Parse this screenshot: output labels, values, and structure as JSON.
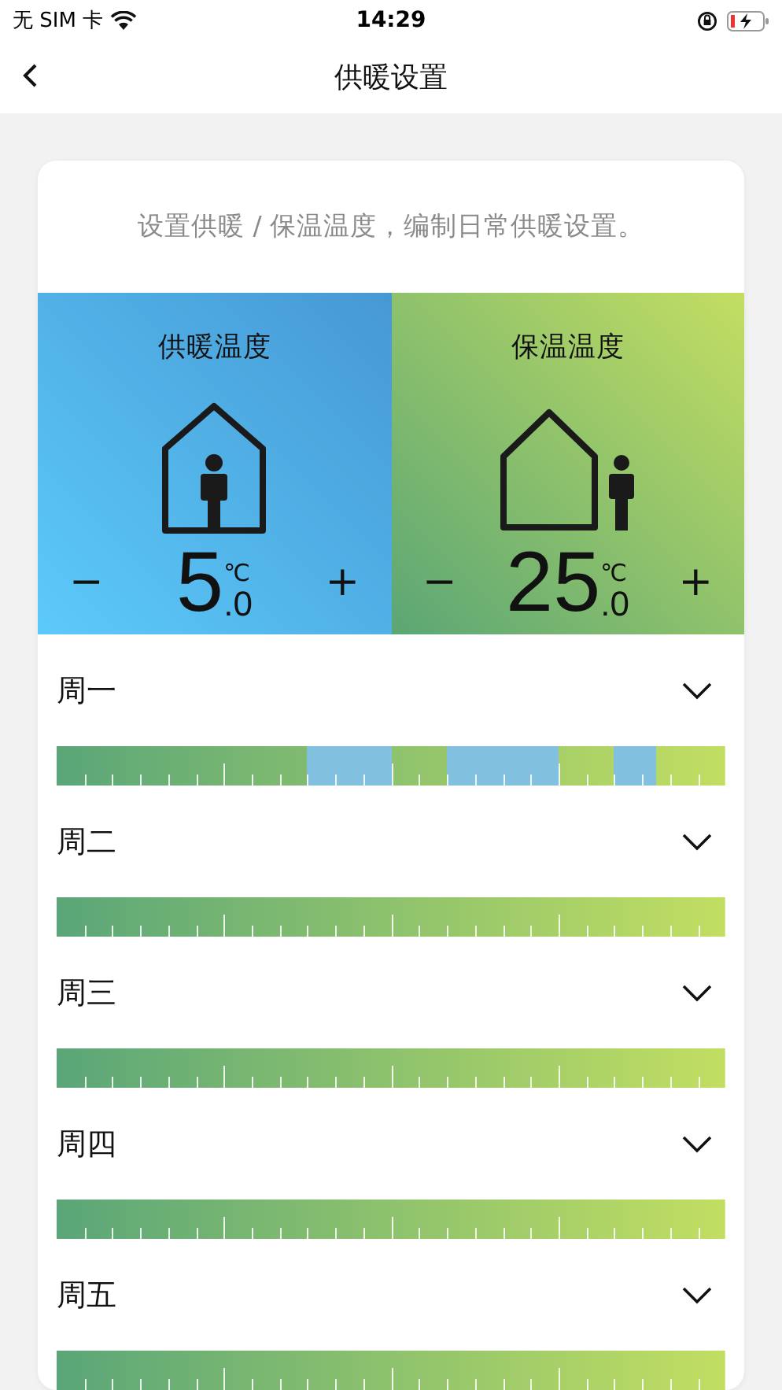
{
  "status_bar": {
    "carrier": "无 SIM 卡",
    "time": "14:29"
  },
  "nav": {
    "title": "供暖设置"
  },
  "intro": "设置供暖 / 保温温度，编制日常供暖设置。",
  "modes": [
    {
      "kind": "heating",
      "title": "供暖温度",
      "whole": "5",
      "fraction": ".0",
      "unit": "℃",
      "minus": "−",
      "plus": "+"
    },
    {
      "kind": "keeping",
      "title": "保温温度",
      "whole": "25",
      "fraction": ".0",
      "unit": "℃",
      "minus": "−",
      "plus": "+"
    }
  ],
  "days": [
    {
      "label": "周一",
      "expanded": false,
      "slots": [
        {
          "kind": "keeping"
        },
        {
          "kind": "keeping"
        },
        {
          "kind": "keeping"
        },
        {
          "kind": "keeping"
        },
        {
          "kind": "keeping"
        },
        {
          "kind": "keeping"
        },
        {
          "kind": "keeping"
        },
        {
          "kind": "keeping"
        },
        {
          "kind": "keeping"
        },
        {
          "kind": "keeping"
        },
        {
          "kind": "keeping"
        },
        {
          "kind": "keeping"
        },
        {
          "kind": "keeping"
        },
        {
          "kind": "keeping"
        },
        {
          "kind": "keeping"
        },
        {
          "kind": "keeping"
        },
        {
          "kind": "keeping"
        },
        {
          "kind": "keeping"
        },
        {
          "kind": "heating"
        },
        {
          "kind": "heating"
        },
        {
          "kind": "heating"
        },
        {
          "kind": "heating"
        },
        {
          "kind": "heating"
        },
        {
          "kind": "heating"
        },
        {
          "kind": "keeping"
        },
        {
          "kind": "keeping"
        },
        {
          "kind": "keeping"
        },
        {
          "kind": "keeping"
        },
        {
          "kind": "heating"
        },
        {
          "kind": "heating"
        },
        {
          "kind": "heating"
        },
        {
          "kind": "heating"
        },
        {
          "kind": "heating"
        },
        {
          "kind": "heating"
        },
        {
          "kind": "heating"
        },
        {
          "kind": "heating"
        },
        {
          "kind": "keeping"
        },
        {
          "kind": "keeping"
        },
        {
          "kind": "keeping"
        },
        {
          "kind": "keeping"
        },
        {
          "kind": "heating"
        },
        {
          "kind": "heating"
        },
        {
          "kind": "heating"
        },
        {
          "kind": "keeping"
        },
        {
          "kind": "keeping"
        },
        {
          "kind": "keeping"
        },
        {
          "kind": "keeping"
        },
        {
          "kind": "keeping"
        }
      ]
    },
    {
      "label": "周二",
      "expanded": false,
      "slots": [
        {
          "kind": "keeping"
        },
        {
          "kind": "keeping"
        },
        {
          "kind": "keeping"
        },
        {
          "kind": "keeping"
        },
        {
          "kind": "keeping"
        },
        {
          "kind": "keeping"
        },
        {
          "kind": "keeping"
        },
        {
          "kind": "keeping"
        },
        {
          "kind": "keeping"
        },
        {
          "kind": "keeping"
        },
        {
          "kind": "keeping"
        },
        {
          "kind": "keeping"
        },
        {
          "kind": "keeping"
        },
        {
          "kind": "keeping"
        },
        {
          "kind": "keeping"
        },
        {
          "kind": "keeping"
        },
        {
          "kind": "keeping"
        },
        {
          "kind": "keeping"
        },
        {
          "kind": "keeping"
        },
        {
          "kind": "keeping"
        },
        {
          "kind": "keeping"
        },
        {
          "kind": "keeping"
        },
        {
          "kind": "keeping"
        },
        {
          "kind": "keeping"
        },
        {
          "kind": "keeping"
        },
        {
          "kind": "keeping"
        },
        {
          "kind": "keeping"
        },
        {
          "kind": "keeping"
        },
        {
          "kind": "keeping"
        },
        {
          "kind": "keeping"
        },
        {
          "kind": "keeping"
        },
        {
          "kind": "keeping"
        },
        {
          "kind": "keeping"
        },
        {
          "kind": "keeping"
        },
        {
          "kind": "keeping"
        },
        {
          "kind": "keeping"
        },
        {
          "kind": "keeping"
        },
        {
          "kind": "keeping"
        },
        {
          "kind": "keeping"
        },
        {
          "kind": "keeping"
        },
        {
          "kind": "keeping"
        },
        {
          "kind": "keeping"
        },
        {
          "kind": "keeping"
        },
        {
          "kind": "keeping"
        },
        {
          "kind": "keeping"
        },
        {
          "kind": "keeping"
        },
        {
          "kind": "keeping"
        },
        {
          "kind": "keeping"
        }
      ]
    },
    {
      "label": "周三",
      "expanded": false,
      "slots": [
        {
          "kind": "keeping"
        },
        {
          "kind": "keeping"
        },
        {
          "kind": "keeping"
        },
        {
          "kind": "keeping"
        },
        {
          "kind": "keeping"
        },
        {
          "kind": "keeping"
        },
        {
          "kind": "keeping"
        },
        {
          "kind": "keeping"
        },
        {
          "kind": "keeping"
        },
        {
          "kind": "keeping"
        },
        {
          "kind": "keeping"
        },
        {
          "kind": "keeping"
        },
        {
          "kind": "keeping"
        },
        {
          "kind": "keeping"
        },
        {
          "kind": "keeping"
        },
        {
          "kind": "keeping"
        },
        {
          "kind": "keeping"
        },
        {
          "kind": "keeping"
        },
        {
          "kind": "keeping"
        },
        {
          "kind": "keeping"
        },
        {
          "kind": "keeping"
        },
        {
          "kind": "keeping"
        },
        {
          "kind": "keeping"
        },
        {
          "kind": "keeping"
        },
        {
          "kind": "keeping"
        },
        {
          "kind": "keeping"
        },
        {
          "kind": "keeping"
        },
        {
          "kind": "keeping"
        },
        {
          "kind": "keeping"
        },
        {
          "kind": "keeping"
        },
        {
          "kind": "keeping"
        },
        {
          "kind": "keeping"
        },
        {
          "kind": "keeping"
        },
        {
          "kind": "keeping"
        },
        {
          "kind": "keeping"
        },
        {
          "kind": "keeping"
        },
        {
          "kind": "keeping"
        },
        {
          "kind": "keeping"
        },
        {
          "kind": "keeping"
        },
        {
          "kind": "keeping"
        },
        {
          "kind": "keeping"
        },
        {
          "kind": "keeping"
        },
        {
          "kind": "keeping"
        },
        {
          "kind": "keeping"
        },
        {
          "kind": "keeping"
        },
        {
          "kind": "keeping"
        },
        {
          "kind": "keeping"
        },
        {
          "kind": "keeping"
        }
      ]
    },
    {
      "label": "周四",
      "expanded": false,
      "slots": [
        {
          "kind": "keeping"
        },
        {
          "kind": "keeping"
        },
        {
          "kind": "keeping"
        },
        {
          "kind": "keeping"
        },
        {
          "kind": "keeping"
        },
        {
          "kind": "keeping"
        },
        {
          "kind": "keeping"
        },
        {
          "kind": "keeping"
        },
        {
          "kind": "keeping"
        },
        {
          "kind": "keeping"
        },
        {
          "kind": "keeping"
        },
        {
          "kind": "keeping"
        },
        {
          "kind": "keeping"
        },
        {
          "kind": "keeping"
        },
        {
          "kind": "keeping"
        },
        {
          "kind": "keeping"
        },
        {
          "kind": "keeping"
        },
        {
          "kind": "keeping"
        },
        {
          "kind": "keeping"
        },
        {
          "kind": "keeping"
        },
        {
          "kind": "keeping"
        },
        {
          "kind": "keeping"
        },
        {
          "kind": "keeping"
        },
        {
          "kind": "keeping"
        },
        {
          "kind": "keeping"
        },
        {
          "kind": "keeping"
        },
        {
          "kind": "keeping"
        },
        {
          "kind": "keeping"
        },
        {
          "kind": "keeping"
        },
        {
          "kind": "keeping"
        },
        {
          "kind": "keeping"
        },
        {
          "kind": "keeping"
        },
        {
          "kind": "keeping"
        },
        {
          "kind": "keeping"
        },
        {
          "kind": "keeping"
        },
        {
          "kind": "keeping"
        },
        {
          "kind": "keeping"
        },
        {
          "kind": "keeping"
        },
        {
          "kind": "keeping"
        },
        {
          "kind": "keeping"
        },
        {
          "kind": "keeping"
        },
        {
          "kind": "keeping"
        },
        {
          "kind": "keeping"
        },
        {
          "kind": "keeping"
        },
        {
          "kind": "keeping"
        },
        {
          "kind": "keeping"
        },
        {
          "kind": "keeping"
        },
        {
          "kind": "keeping"
        }
      ]
    },
    {
      "label": "周五",
      "expanded": false,
      "slots": [
        {
          "kind": "keeping"
        },
        {
          "kind": "keeping"
        },
        {
          "kind": "keeping"
        },
        {
          "kind": "keeping"
        },
        {
          "kind": "keeping"
        },
        {
          "kind": "keeping"
        },
        {
          "kind": "keeping"
        },
        {
          "kind": "keeping"
        },
        {
          "kind": "keeping"
        },
        {
          "kind": "keeping"
        },
        {
          "kind": "keeping"
        },
        {
          "kind": "keeping"
        },
        {
          "kind": "keeping"
        },
        {
          "kind": "keeping"
        },
        {
          "kind": "keeping"
        },
        {
          "kind": "keeping"
        },
        {
          "kind": "keeping"
        },
        {
          "kind": "keeping"
        },
        {
          "kind": "keeping"
        },
        {
          "kind": "keeping"
        },
        {
          "kind": "keeping"
        },
        {
          "kind": "keeping"
        },
        {
          "kind": "keeping"
        },
        {
          "kind": "keeping"
        },
        {
          "kind": "keeping"
        },
        {
          "kind": "keeping"
        },
        {
          "kind": "keeping"
        },
        {
          "kind": "keeping"
        },
        {
          "kind": "keeping"
        },
        {
          "kind": "keeping"
        },
        {
          "kind": "keeping"
        },
        {
          "kind": "keeping"
        },
        {
          "kind": "keeping"
        },
        {
          "kind": "keeping"
        },
        {
          "kind": "keeping"
        },
        {
          "kind": "keeping"
        },
        {
          "kind": "keeping"
        },
        {
          "kind": "keeping"
        },
        {
          "kind": "keeping"
        },
        {
          "kind": "keeping"
        },
        {
          "kind": "keeping"
        },
        {
          "kind": "keeping"
        },
        {
          "kind": "keeping"
        },
        {
          "kind": "keeping"
        },
        {
          "kind": "keeping"
        },
        {
          "kind": "keeping"
        },
        {
          "kind": "keeping"
        },
        {
          "kind": "keeping"
        }
      ]
    }
  ]
}
